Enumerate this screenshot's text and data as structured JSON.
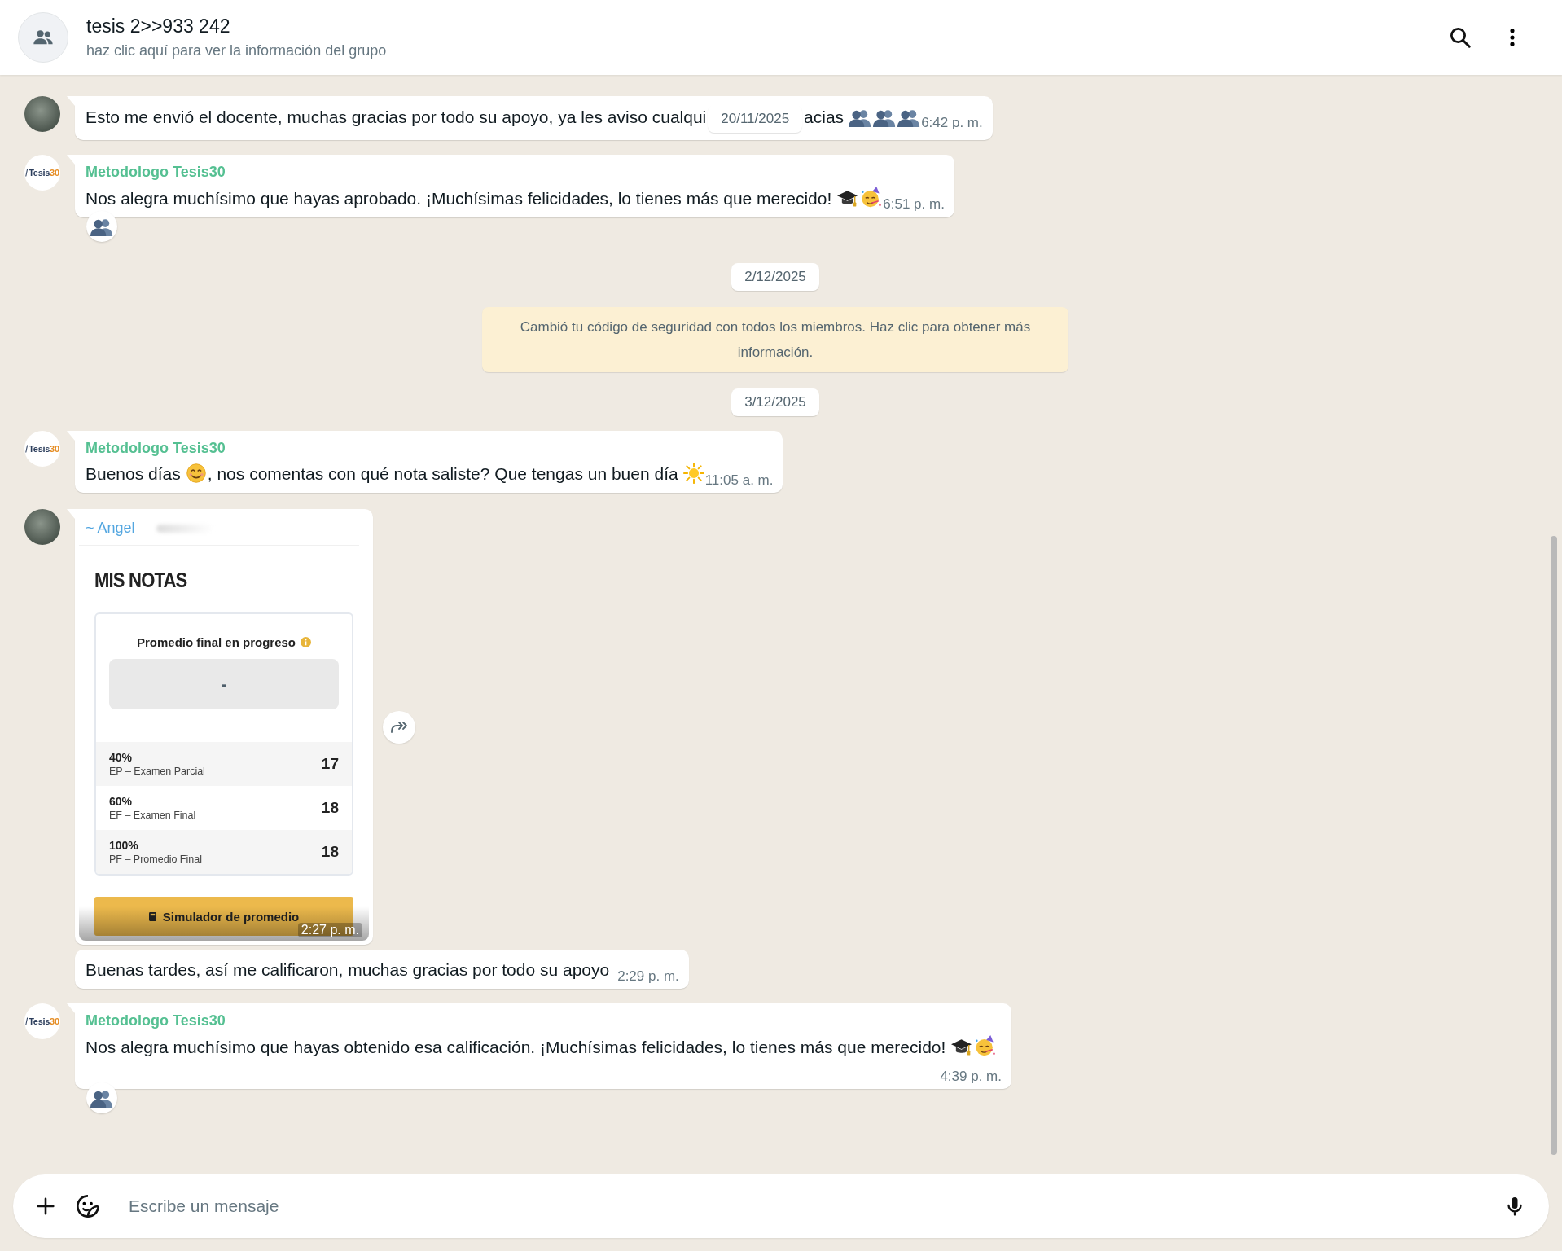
{
  "header": {
    "title": "tesis 2>>933 242",
    "subtitle": "haz clic aquí para ver la información del grupo"
  },
  "messages": [
    {
      "kind": "text",
      "avatar": {
        "kind": "photo"
      },
      "parts": [
        {
          "kind": "text",
          "text": "Esto me envió el docente, muchas gracias por todo su apoyo, ya les aviso cualqui"
        },
        {
          "kind": "date",
          "text": "20/11/2025"
        },
        {
          "kind": "text",
          "text": "acias"
        },
        {
          "kind": "busts"
        },
        {
          "kind": "busts"
        },
        {
          "kind": "busts"
        }
      ],
      "time": "6:42 p. m."
    },
    {
      "kind": "text",
      "avatar": {
        "kind": "logo",
        "text": "Tesis",
        "number": "30"
      },
      "sender": "Metodologo Tesis30",
      "parts": [
        {
          "kind": "text",
          "text": "Nos alegra muchísimo que hayas aprobado. ¡Muchísimas felicidades, lo tienes más que merecido!"
        },
        {
          "kind": "graduation-cap"
        },
        {
          "kind": "partying-face"
        }
      ],
      "time": "6:51 p. m.",
      "reaction": {
        "kind": "busts"
      }
    },
    {
      "kind": "date",
      "text": "2/12/2025"
    },
    {
      "kind": "system",
      "text": "Cambió tu código de seguridad con todos los miembros. Haz clic para obtener más información."
    },
    {
      "kind": "date",
      "text": "3/12/2025"
    },
    {
      "kind": "text",
      "avatar": {
        "kind": "logo",
        "text": "Tesis",
        "number": "30"
      },
      "sender": "Metodologo Tesis30",
      "parts": [
        {
          "kind": "text",
          "text": "Buenos días"
        },
        {
          "kind": "smiling-face"
        },
        {
          "kind": "text",
          "text": ", nos comentas con qué nota saliste? Que tengas un buen día"
        },
        {
          "kind": "sun"
        }
      ],
      "time": "11:05 a. m."
    },
    {
      "kind": "image",
      "avatar": {
        "kind": "photo"
      },
      "sender": "~ Angel",
      "card": {
        "title": "MIS NOTAS",
        "summary_label": "Promedio final en progreso",
        "summary_value": "-",
        "rows": [
          {
            "weight": "40%",
            "name": "EP – Examen Parcial",
            "grade": "17"
          },
          {
            "weight": "60%",
            "name": "EF – Examen Final",
            "grade": "18"
          },
          {
            "weight": "100%",
            "name": "PF – Promedio Final",
            "grade": "18"
          }
        ],
        "button": "Simulador de promedio"
      },
      "time": "2:27 p. m."
    },
    {
      "kind": "text",
      "parts": [
        {
          "kind": "text",
          "text": "Buenas tardes, así me calificaron, muchas gracias por todo su apoyo"
        }
      ],
      "time": "2:29 p. m."
    },
    {
      "kind": "text",
      "avatar": {
        "kind": "logo",
        "text": "Tesis",
        "number": "30"
      },
      "sender": "Metodologo Tesis30",
      "parts": [
        {
          "kind": "text",
          "text": "Nos alegra muchísimo que hayas obtenido esa calificación. ¡Muchísimas felicidades, lo tienes más que merecido!"
        },
        {
          "kind": "graduation-cap"
        },
        {
          "kind": "partying-face"
        }
      ],
      "time": "4:39 p. m.",
      "reaction": {
        "kind": "busts"
      }
    }
  ],
  "composer": {
    "placeholder": "Escribe un mensaje"
  }
}
